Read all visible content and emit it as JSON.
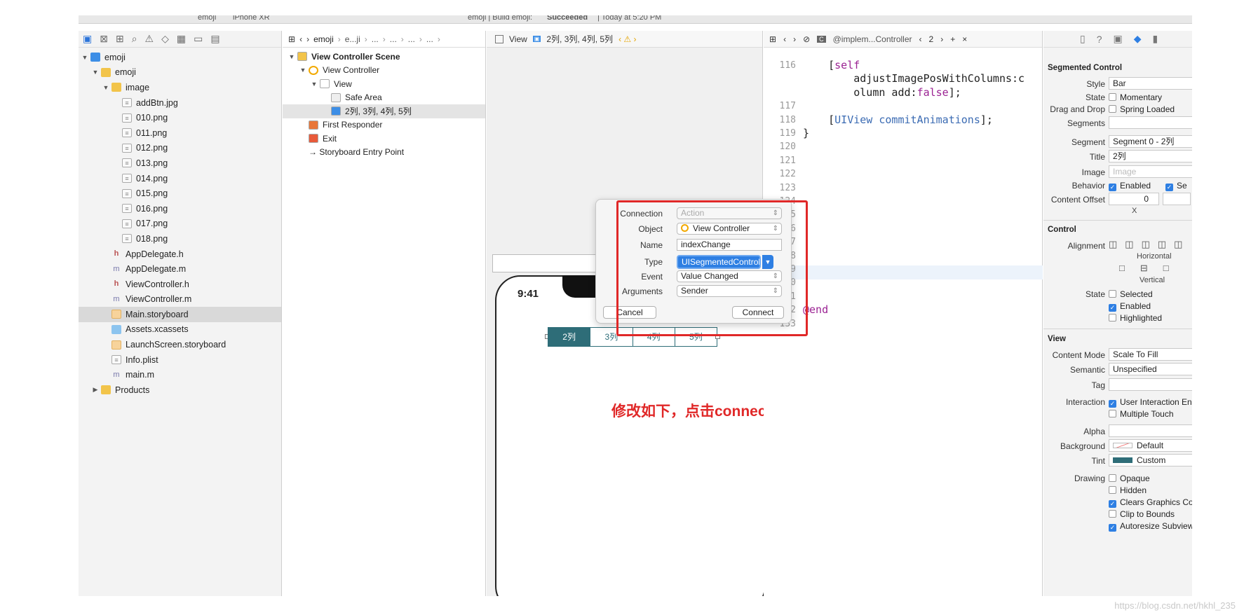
{
  "toolbar": {
    "scheme": "emoji",
    "device": "iPhone XR",
    "status_project": "emoji | Build emoji:",
    "status_result": "Succeeded",
    "status_time": "| Today at 5:20 PM"
  },
  "navigator": {
    "icons": [
      "folder-icon",
      "source-control-icon",
      "symbol-icon",
      "search-icon",
      "warning-icon",
      "test-icon",
      "debug-icon",
      "breakpoint-icon",
      "report-icon"
    ],
    "items": [
      {
        "label": "emoji",
        "depth": 0,
        "icon": "project",
        "tri": "▼"
      },
      {
        "label": "emoji",
        "depth": 1,
        "icon": "folder",
        "tri": "▼"
      },
      {
        "label": "image",
        "depth": 2,
        "icon": "folder",
        "tri": "▼"
      },
      {
        "label": "addBtn.jpg",
        "depth": 3,
        "icon": "file"
      },
      {
        "label": "010.png",
        "depth": 3,
        "icon": "file"
      },
      {
        "label": "011.png",
        "depth": 3,
        "icon": "file"
      },
      {
        "label": "012.png",
        "depth": 3,
        "icon": "file"
      },
      {
        "label": "013.png",
        "depth": 3,
        "icon": "file"
      },
      {
        "label": "014.png",
        "depth": 3,
        "icon": "file"
      },
      {
        "label": "015.png",
        "depth": 3,
        "icon": "file"
      },
      {
        "label": "016.png",
        "depth": 3,
        "icon": "file"
      },
      {
        "label": "017.png",
        "depth": 3,
        "icon": "file"
      },
      {
        "label": "018.png",
        "depth": 3,
        "icon": "file"
      },
      {
        "label": "AppDelegate.h",
        "depth": 2,
        "icon": "h"
      },
      {
        "label": "AppDelegate.m",
        "depth": 2,
        "icon": "m"
      },
      {
        "label": "ViewController.h",
        "depth": 2,
        "icon": "h"
      },
      {
        "label": "ViewController.m",
        "depth": 2,
        "icon": "m"
      },
      {
        "label": "Main.storyboard",
        "depth": 2,
        "icon": "sb",
        "selected": true
      },
      {
        "label": "Assets.xcassets",
        "depth": 2,
        "icon": "asset"
      },
      {
        "label": "LaunchScreen.storyboard",
        "depth": 2,
        "icon": "sb"
      },
      {
        "label": "Info.plist",
        "depth": 2,
        "icon": "file"
      },
      {
        "label": "main.m",
        "depth": 2,
        "icon": "m"
      },
      {
        "label": "Products",
        "depth": 1,
        "icon": "folder",
        "tri": "▶"
      }
    ]
  },
  "storyboard_jump": [
    "emoji",
    "e...ji",
    "...",
    "...",
    "...",
    "...",
    "View",
    "2列, 3列, 4列, 5列"
  ],
  "outline": [
    {
      "label": "View Controller Scene",
      "depth": 0,
      "tri": "▼",
      "bold": true
    },
    {
      "label": "View Controller",
      "depth": 1,
      "tri": "▼"
    },
    {
      "label": "View",
      "depth": 2,
      "tri": "▼"
    },
    {
      "label": "Safe Area",
      "depth": 3
    },
    {
      "label": "2列, 3列, 4列, 5列",
      "depth": 3,
      "selected": true
    },
    {
      "label": "First Responder",
      "depth": 1
    },
    {
      "label": "Exit",
      "depth": 1
    },
    {
      "label": "→ Storyboard Entry Point",
      "depth": 1
    }
  ],
  "canvas": {
    "time": "9:41",
    "segments": [
      "2列",
      "3列",
      "4列",
      "5列"
    ],
    "annotation": "修改如下，点击connect"
  },
  "popover": {
    "connection_label": "Connection",
    "connection_value": "Action",
    "object_label": "Object",
    "object_value": "View Controller",
    "name_label": "Name",
    "name_value": "indexChange",
    "type_label": "Type",
    "type_value": "UISegmentedControl",
    "event_label": "Event",
    "event_value": "Value Changed",
    "arguments_label": "Arguments",
    "arguments_value": "Sender",
    "cancel": "Cancel",
    "connect": "Connect"
  },
  "code_jump": {
    "file": "@implem...Controller",
    "count": "2"
  },
  "code": [
    {
      "n": "116",
      "text": "    [self"
    },
    {
      "n": "",
      "text": "        adjustImagePosWithColumns:c"
    },
    {
      "n": "",
      "text": "        olumn add:false];"
    },
    {
      "n": "117",
      "text": ""
    },
    {
      "n": "118",
      "text": "    [UIView commitAnimations];"
    },
    {
      "n": "119",
      "text": "}"
    },
    {
      "n": "120",
      "text": ""
    },
    {
      "n": "121",
      "text": ""
    },
    {
      "n": "122",
      "text": ""
    },
    {
      "n": "123",
      "text": ""
    },
    {
      "n": "124",
      "text": ""
    },
    {
      "n": "125",
      "text": ""
    },
    {
      "n": "126",
      "text": ""
    },
    {
      "n": "127",
      "text": ""
    },
    {
      "n": "128",
      "text": ""
    },
    {
      "n": "129",
      "text": ""
    },
    {
      "n": "130",
      "text": ""
    },
    {
      "n": "131",
      "text": ""
    },
    {
      "n": "132",
      "text": "@end"
    },
    {
      "n": "133",
      "text": ""
    }
  ],
  "inspector": {
    "seg_title": "Segmented Control",
    "style_label": "Style",
    "style_value": "Bar",
    "state_label": "State",
    "state_value": "Momentary",
    "drag_label": "Drag and Drop",
    "drag_value": "Spring Loaded",
    "segments_label": "Segments",
    "segment_label": "Segment",
    "segment_value": "Segment 0 - 2列",
    "title_label": "Title",
    "title_value": "2列",
    "image_label": "Image",
    "image_placeholder": "Image",
    "behavior_label": "Behavior",
    "behavior_enabled": "Enabled",
    "behavior_second": "Se",
    "offset_label": "Content Offset",
    "offset_value": "0",
    "offset_x": "X",
    "control_title": "Control",
    "alignment_label": "Alignment",
    "horizontal": "Horizontal",
    "vertical": "Vertical",
    "cstate_label": "State",
    "selected": "Selected",
    "enabled": "Enabled",
    "highlighted": "Highlighted",
    "view_title": "View",
    "mode_label": "Content Mode",
    "mode_value": "Scale To Fill",
    "semantic_label": "Semantic",
    "semantic_value": "Unspecified",
    "tag_label": "Tag",
    "interaction_label": "Interaction",
    "interaction_value": "User Interaction En",
    "multitouch": "Multiple Touch",
    "alpha_label": "Alpha",
    "background_label": "Background",
    "background_value": "Default",
    "tint_label": "Tint",
    "tint_value": "Custom",
    "drawing_label": "Drawing",
    "opaque": "Opaque",
    "hidden": "Hidden",
    "clears": "Clears Graphics Co",
    "clip": "Clip to Bounds",
    "autoresize": "Autoresize Subview"
  },
  "watermark": "https://blog.csdn.net/hkhl_235",
  "colors": {
    "accent": "#2e7fe3",
    "segment": "#2e6d78",
    "annotation": "#e02828"
  }
}
